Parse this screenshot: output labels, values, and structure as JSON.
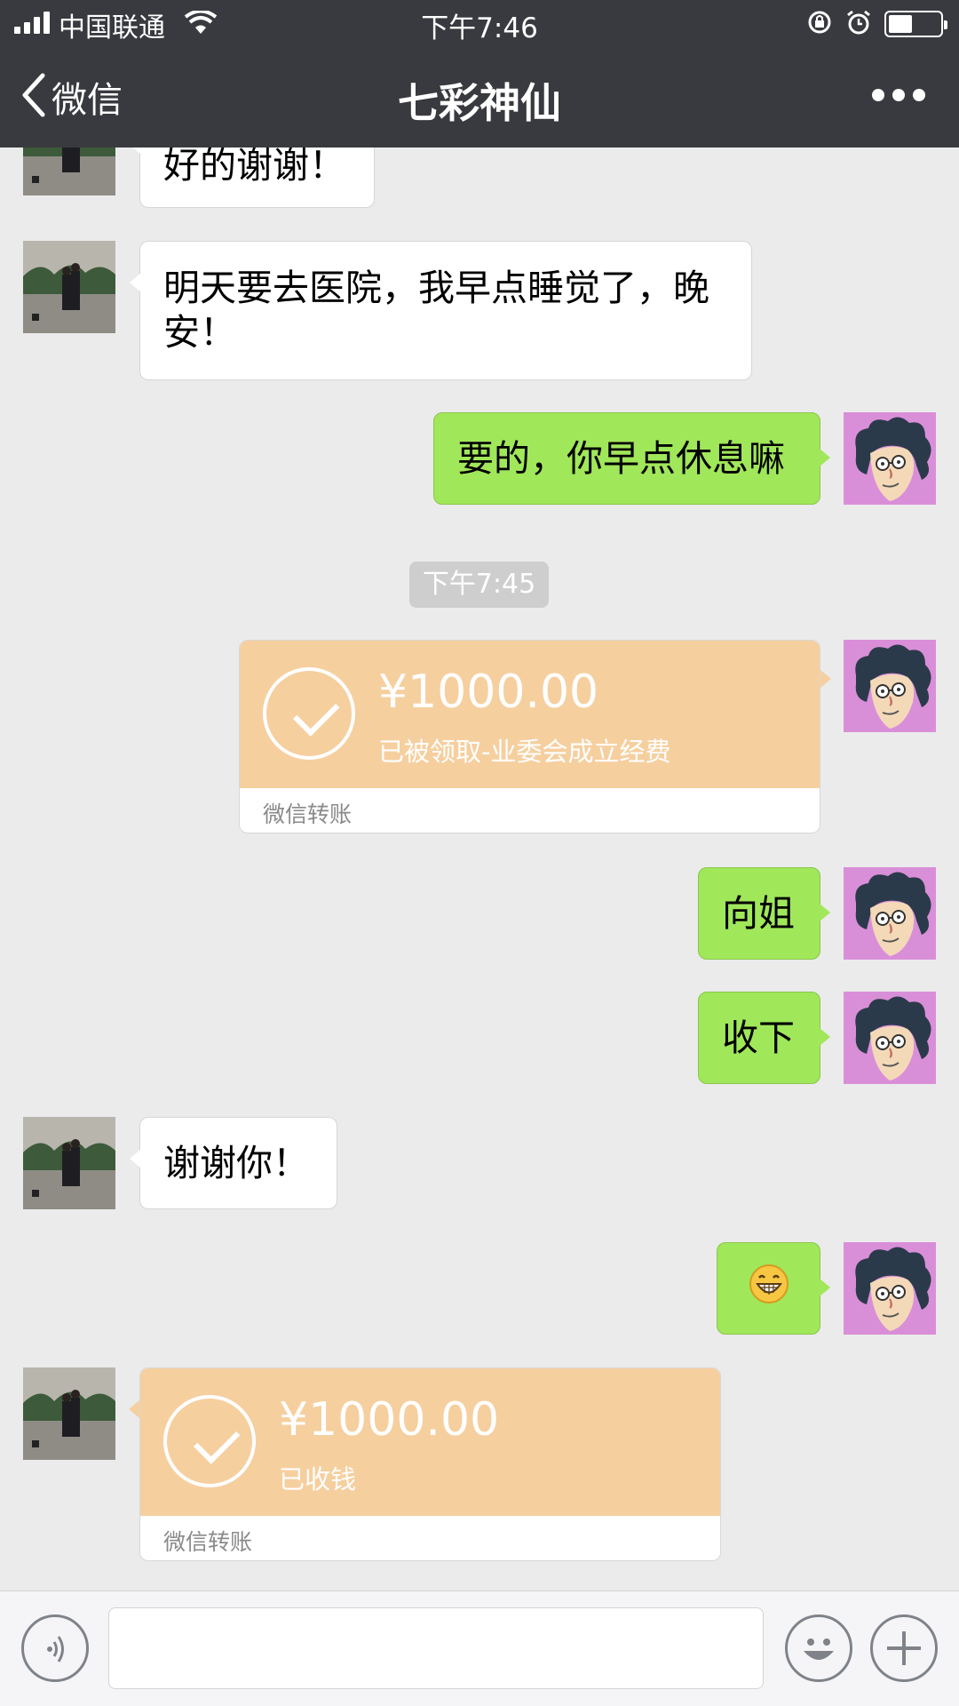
{
  "status_bar": {
    "carrier": "中国联通",
    "time": "下午7:46",
    "battery_level": 0.45
  },
  "nav": {
    "back_label": "微信",
    "title": "七彩神仙"
  },
  "messages": [
    {
      "side": "in",
      "type": "text",
      "text": "好的谢谢！"
    },
    {
      "side": "in",
      "type": "text",
      "text": "明天要去医院，我早点睡觉了，晚安！"
    },
    {
      "side": "out",
      "type": "text",
      "text": "要的，你早点休息嘛"
    },
    {
      "type": "timestamp",
      "text": "下午7:45"
    },
    {
      "side": "out",
      "type": "transfer",
      "amount": "¥1000.00",
      "status": "已被领取-业委会成立经费",
      "footer": "微信转账"
    },
    {
      "side": "out",
      "type": "text",
      "text": "向姐"
    },
    {
      "side": "out",
      "type": "text",
      "text": "收下"
    },
    {
      "side": "in",
      "type": "text",
      "text": "谢谢你！"
    },
    {
      "side": "out",
      "type": "emoji",
      "icon": "grinning-face-emoji"
    },
    {
      "side": "in",
      "type": "transfer",
      "amount": "¥1000.00",
      "status": "已收钱",
      "footer": "微信转账"
    }
  ],
  "colors": {
    "header_bg": "#393a3f",
    "chat_bg": "#ebebeb",
    "sent_bubble": "#a0e75a",
    "received_bubble": "#ffffff",
    "transfer_card": "#f6cf9f"
  },
  "input_bar": {
    "icons": [
      "voice-icon",
      "emoji-icon",
      "plus-icon"
    ]
  }
}
